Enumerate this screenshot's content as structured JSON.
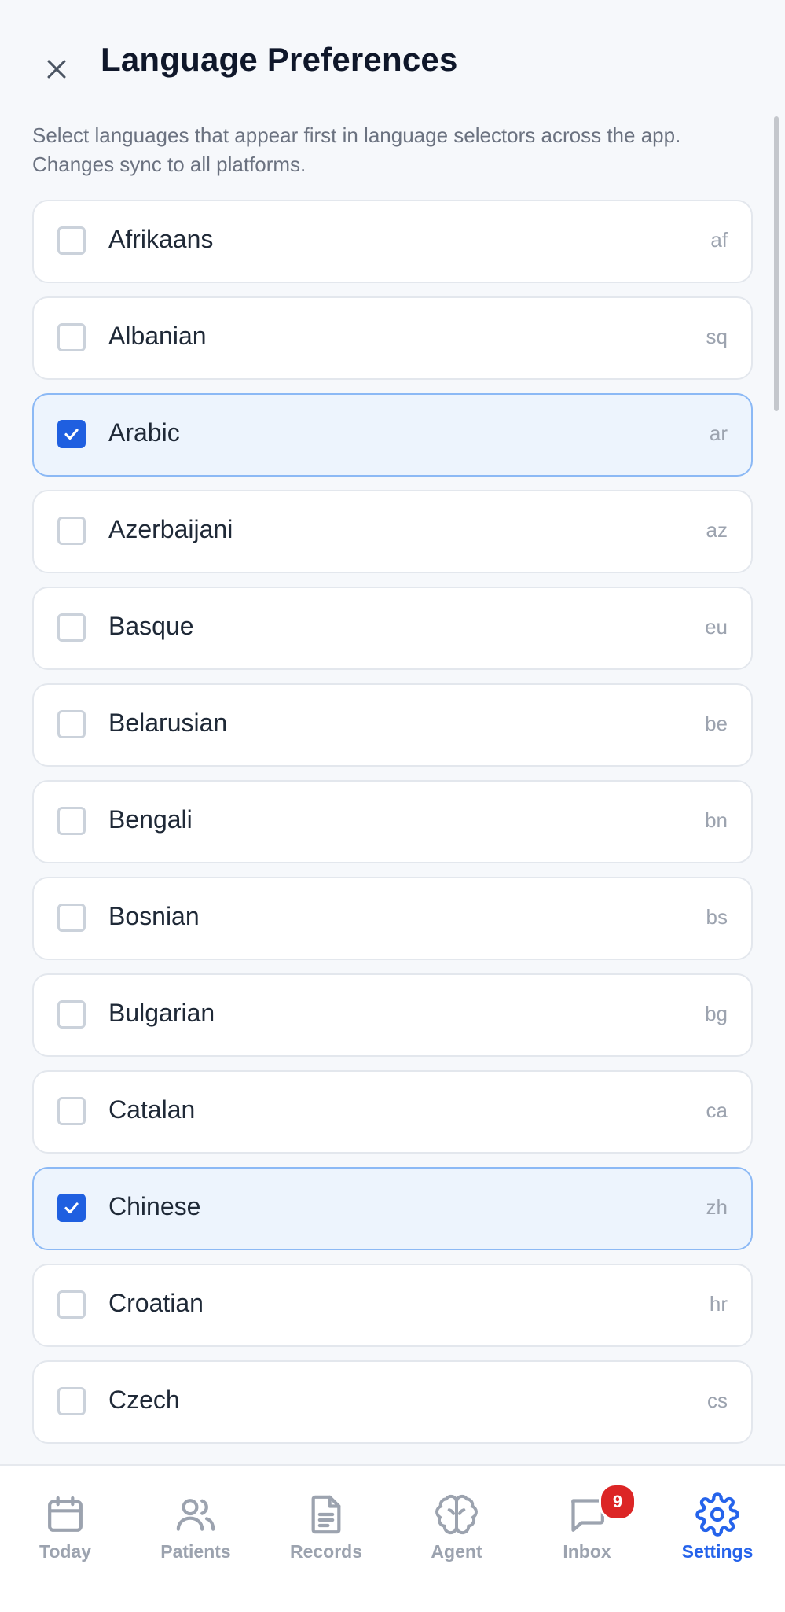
{
  "header": {
    "title": "Language Preferences",
    "close_icon": "close-icon",
    "description": "Select languages that appear first in language selectors across the app. Changes sync to all platforms."
  },
  "languages": [
    {
      "name": "Afrikaans",
      "code": "af",
      "checked": false
    },
    {
      "name": "Albanian",
      "code": "sq",
      "checked": false
    },
    {
      "name": "Arabic",
      "code": "ar",
      "checked": true
    },
    {
      "name": "Azerbaijani",
      "code": "az",
      "checked": false
    },
    {
      "name": "Basque",
      "code": "eu",
      "checked": false
    },
    {
      "name": "Belarusian",
      "code": "be",
      "checked": false
    },
    {
      "name": "Bengali",
      "code": "bn",
      "checked": false
    },
    {
      "name": "Bosnian",
      "code": "bs",
      "checked": false
    },
    {
      "name": "Bulgarian",
      "code": "bg",
      "checked": false
    },
    {
      "name": "Catalan",
      "code": "ca",
      "checked": false
    },
    {
      "name": "Chinese",
      "code": "zh",
      "checked": true
    },
    {
      "name": "Croatian",
      "code": "hr",
      "checked": false
    },
    {
      "name": "Czech",
      "code": "cs",
      "checked": false
    }
  ],
  "tabbar": {
    "tabs": [
      {
        "label": "Today",
        "icon": "calendar-icon",
        "active": false
      },
      {
        "label": "Patients",
        "icon": "users-icon",
        "active": false
      },
      {
        "label": "Records",
        "icon": "document-icon",
        "active": false
      },
      {
        "label": "Agent",
        "icon": "brain-icon",
        "active": false
      },
      {
        "label": "Inbox",
        "icon": "message-icon",
        "active": false,
        "badge": "9"
      },
      {
        "label": "Settings",
        "icon": "gear-icon",
        "active": true
      }
    ]
  },
  "colors": {
    "accent": "#2563eb",
    "checkbox_checked": "#1f5fe0",
    "selected_row_bg": "#edf4fd",
    "selected_row_border": "#8cb9f5",
    "badge": "#dc2626",
    "inactive": "#9ca3af"
  }
}
